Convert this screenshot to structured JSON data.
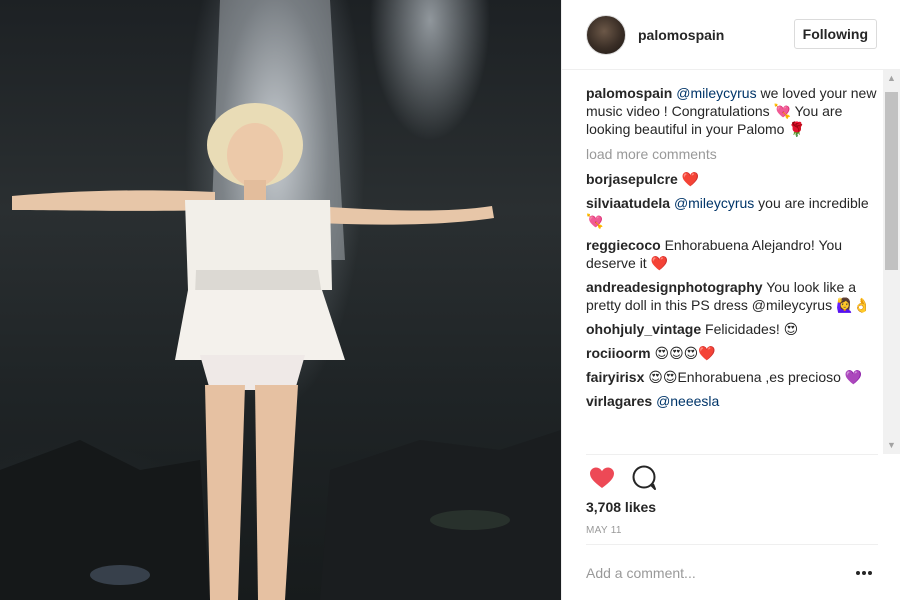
{
  "post": {
    "photo_icon": "photo",
    "author": "palomospain",
    "follow_label": "Following",
    "caption": {
      "user": "palomospain",
      "mention": "@mileycyrus",
      "text": " we loved your new music video ! Congratulations 💘 You are looking beautiful in your Palomo 🌹"
    },
    "load_more_label": "load more comments",
    "comments": [
      {
        "user": "borjasepulcre",
        "mention": "",
        "text": " ❤️"
      },
      {
        "user": "silviaatudela",
        "mention": "@mileycyrus",
        "text": " you are incredible 💘"
      },
      {
        "user": "reggiecoco",
        "mention": "",
        "text": " Enhorabuena Alejandro! You deserve it ❤️"
      },
      {
        "user": "andreadesignphotography",
        "mention": "",
        "text": " You look like a pretty doll in this PS dress @mileycyrus 🙋‍♀️👌"
      },
      {
        "user": "ohohjuly_vintage",
        "mention": "",
        "text": " Felicidades! 😍"
      },
      {
        "user": "rociioorm",
        "mention": "",
        "text": " 😍😍😍❤️"
      },
      {
        "user": "fairyirisx",
        "mention": "",
        "text": " 😍😍Enhorabuena ,es precioso 💜"
      },
      {
        "user": "virlagares",
        "mention": "@neeesla",
        "text": ""
      }
    ],
    "likes_label": "3,708 likes",
    "date_label": "MAY 11",
    "add_comment_placeholder": "Add a comment...",
    "icons": {
      "like": "heart-icon",
      "comment": "comment-bubble-icon",
      "more": "more-options-icon",
      "scroll_up": "scroll-up-arrow",
      "scroll_down": "scroll-down-arrow"
    },
    "colors": {
      "like_red": "#ed4956",
      "mention_blue": "#003569",
      "muted": "#999999"
    }
  }
}
